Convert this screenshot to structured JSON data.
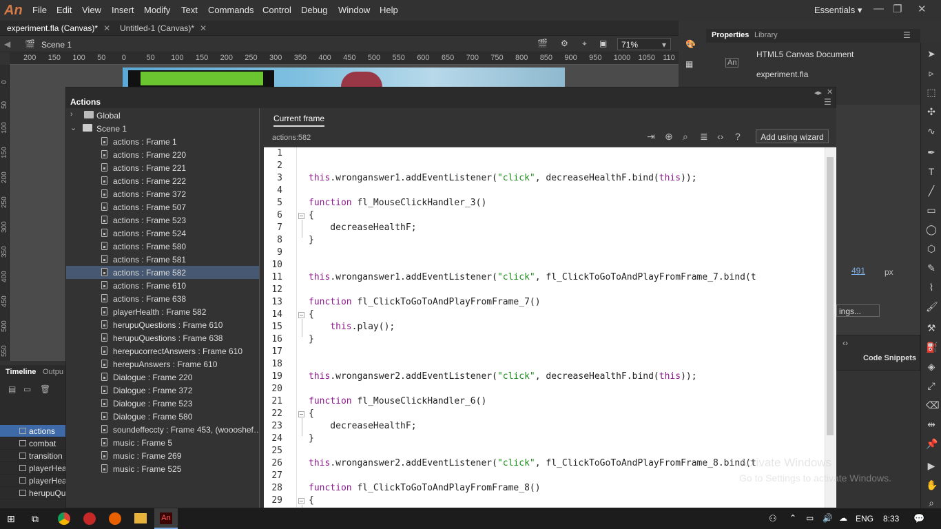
{
  "app": {
    "logo": "An",
    "workspace": "Essentials"
  },
  "menu": [
    "File",
    "Edit",
    "View",
    "Insert",
    "Modify",
    "Text",
    "Commands",
    "Control",
    "Debug",
    "Window",
    "Help"
  ],
  "doc_tabs": [
    {
      "label": "experiment.fla (Canvas)*",
      "active": true
    },
    {
      "label": "Untitled-1 (Canvas)*",
      "active": false
    }
  ],
  "scene": {
    "label": "Scene 1",
    "zoom": "71%"
  },
  "ruler_h": [
    "200",
    "150",
    "100",
    "50",
    "0",
    "50",
    "100",
    "150",
    "200",
    "250",
    "300",
    "350",
    "400",
    "450",
    "500",
    "550",
    "600",
    "650",
    "700",
    "750",
    "800",
    "850",
    "900",
    "950",
    "1000",
    "1050",
    "110"
  ],
  "ruler_v": [
    "0",
    "50",
    "100",
    "150",
    "200",
    "250",
    "300",
    "350",
    "400",
    "450",
    "500",
    "550"
  ],
  "properties": {
    "tabs": [
      "Properties",
      "Library"
    ],
    "doc_type": "HTML5 Canvas Document",
    "file": "experiment.fla",
    "value_491": "491",
    "unit": "px",
    "settings": "ings..."
  },
  "code_snippets": "Code Snippets",
  "timeline": {
    "tabs": [
      "Timeline",
      "Outpu"
    ],
    "layers": [
      {
        "name": "actions",
        "active": true
      },
      {
        "name": "combat",
        "active": false
      },
      {
        "name": "transition",
        "active": false
      },
      {
        "name": "playerHea",
        "active": false
      },
      {
        "name": "playerHea",
        "active": false
      },
      {
        "name": "herupuQue",
        "active": false
      }
    ]
  },
  "actions_panel": {
    "title": "Actions",
    "current_tab": "Current frame",
    "script_id": "actions:582",
    "wizard": "Add using wizard",
    "tree": {
      "global": "Global",
      "scene": "Scene 1",
      "items": [
        "actions : Frame 1",
        "actions : Frame 220",
        "actions : Frame 221",
        "actions : Frame 222",
        "actions : Frame 372",
        "actions : Frame 507",
        "actions : Frame 523",
        "actions : Frame 524",
        "actions : Frame 580",
        "actions : Frame 581",
        "actions : Frame 582",
        "actions : Frame 610",
        "actions : Frame 638",
        "playerHealth : Frame 582",
        "herupuQuestions : Frame 610",
        "herupuQuestions : Frame 638",
        "herepucorrectAnswers : Frame 610",
        "herepuAnswers : Frame 610",
        "Dialogue : Frame 220",
        "Dialogue : Frame 372",
        "Dialogue : Frame 523",
        "Dialogue : Frame 580",
        "soundeffeccty : Frame 453, (woooshef…",
        "music : Frame 5",
        "music : Frame 269",
        "music : Frame 525"
      ],
      "selected_index": 10
    },
    "code_lines": [
      "",
      "",
      "this.wronganswer1.addEventListener(\"click\", decreaseHealthF.bind(this));",
      "",
      "function fl_MouseClickHandler_3()",
      "{",
      "    decreaseHealthF;",
      "}",
      "",
      "",
      "this.wronganswer1.addEventListener(\"click\", fl_ClickToGoToAndPlayFromFrame_7.bind(t",
      "",
      "function fl_ClickToGoToAndPlayFromFrame_7()",
      "{",
      "    this.play();",
      "}",
      "",
      "",
      "this.wronganswer2.addEventListener(\"click\", decreaseHealthF.bind(this));",
      "",
      "function fl_MouseClickHandler_6()",
      "{",
      "    decreaseHealthF;",
      "}",
      "",
      "this.wronganswer2.addEventListener(\"click\", fl_ClickToGoToAndPlayFromFrame_8.bind(t",
      "",
      "function fl_ClickToGoToAndPlayFromFrame_8()",
      "{"
    ]
  },
  "watermark": {
    "line1": "Activate Windows",
    "line2": "Go to Settings to activate Windows."
  },
  "taskbar": {
    "lang": "ENG",
    "time": "8:33"
  }
}
